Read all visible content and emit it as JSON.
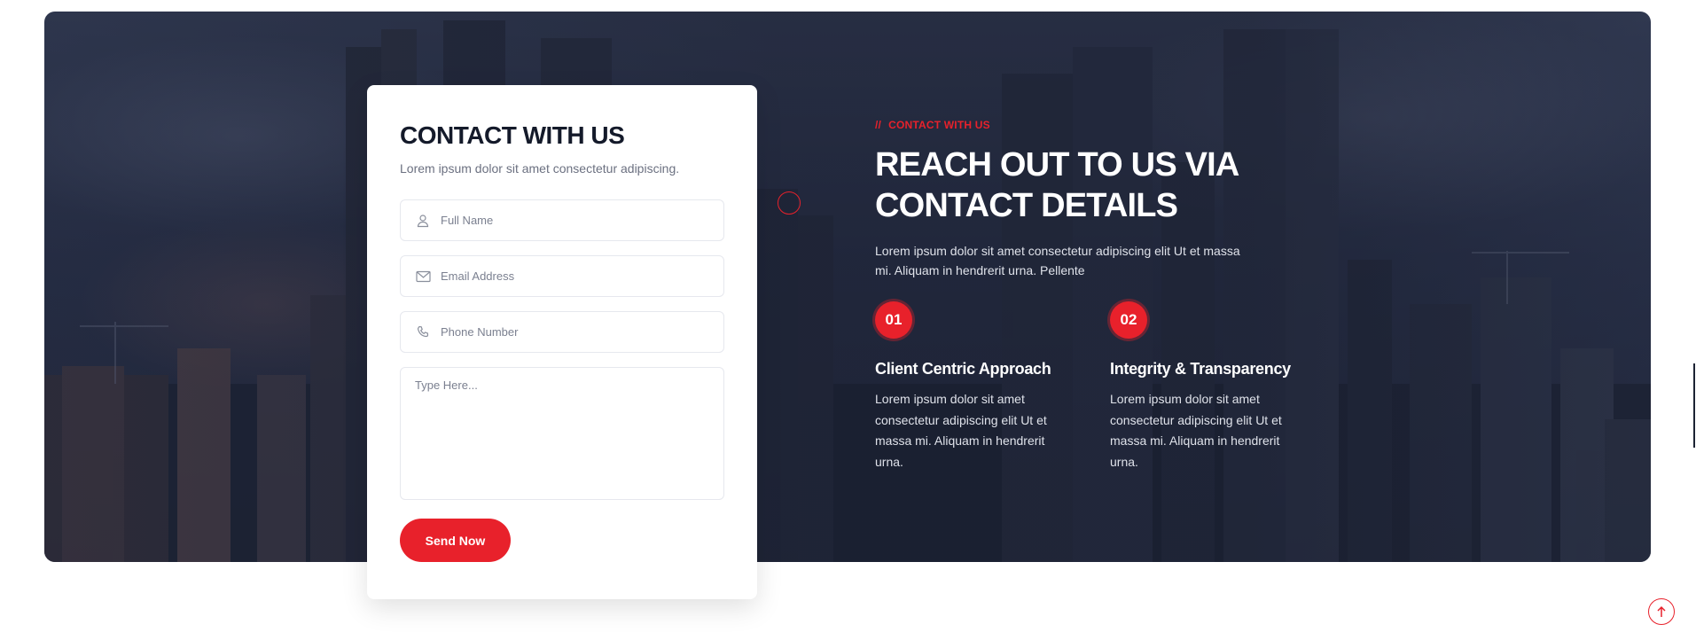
{
  "form": {
    "title": "CONTACT WITH US",
    "subtitle": "Lorem ipsum dolor sit amet consectetur adipiscing.",
    "fields": {
      "name_placeholder": "Full Name",
      "email_placeholder": "Email Address",
      "phone_placeholder": "Phone Number",
      "message_placeholder": "Type Here..."
    },
    "submit_label": "Send Now"
  },
  "info": {
    "eyebrow_prefix": "//",
    "eyebrow": "CONTACT WITH US",
    "heading_line1": "REACH OUT TO US VIA",
    "heading_line2": "CONTACT DETAILS",
    "lead": "Lorem ipsum dolor sit amet consectetur adipiscing elit Ut et massa mi. Aliquam in hendrerit urna. Pellente",
    "features": [
      {
        "number": "01",
        "title": "Client Centric Approach",
        "text": "Lorem ipsum dolor sit amet consectetur adipiscing elit Ut et massa mi. Aliquam in hendrerit urna."
      },
      {
        "number": "02",
        "title": "Integrity & Transparency",
        "text": "Lorem ipsum dolor sit amet consectetur adipiscing elit Ut et massa mi. Aliquam in hendrerit urna."
      }
    ]
  },
  "icons": {
    "name": "user-icon",
    "email": "envelope-icon",
    "phone": "phone-icon",
    "scroll_top": "arrow-up-icon"
  },
  "colors": {
    "accent": "#e8212b",
    "heading_dark": "#141a2a",
    "banner_bg": "#2d3650"
  }
}
